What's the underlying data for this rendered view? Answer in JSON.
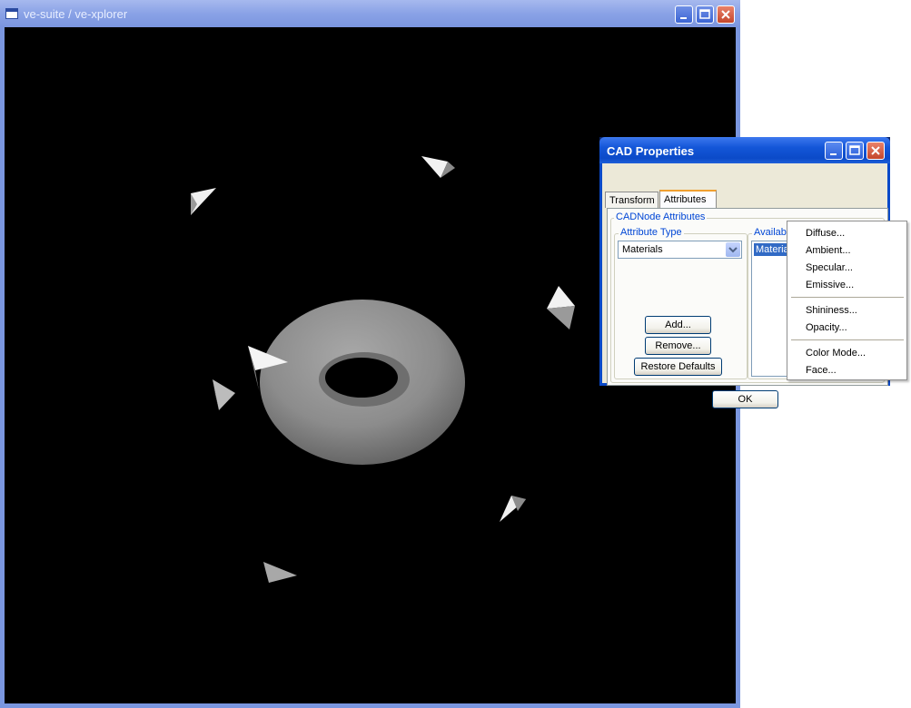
{
  "main_window": {
    "title": "ve-suite / ve-xplorer"
  },
  "cad_dialog": {
    "title": "CAD Properties",
    "tabs": [
      {
        "label": "Transform"
      },
      {
        "label": "Attributes"
      }
    ],
    "group_label": "CADNode Attributes",
    "attribute_type": {
      "label": "Attribute Type",
      "selected": "Materials"
    },
    "buttons": {
      "add": "Add...",
      "remove": "Remove...",
      "restore": "Restore Defaults",
      "ok": "OK"
    },
    "available": {
      "label": "Available Attributes",
      "selected_item": "Materials"
    }
  },
  "context_menu": {
    "items": [
      {
        "label": "Diffuse..."
      },
      {
        "label": "Ambient..."
      },
      {
        "label": "Specular..."
      },
      {
        "label": "Emissive..."
      },
      {
        "label": "Shininess..."
      },
      {
        "label": "Opacity..."
      },
      {
        "label": "Color Mode..."
      },
      {
        "label": "Face..."
      }
    ]
  },
  "colors": {
    "viewport_background": "#000000",
    "torus": "#8a8a8a",
    "selection": "#316ac5"
  }
}
